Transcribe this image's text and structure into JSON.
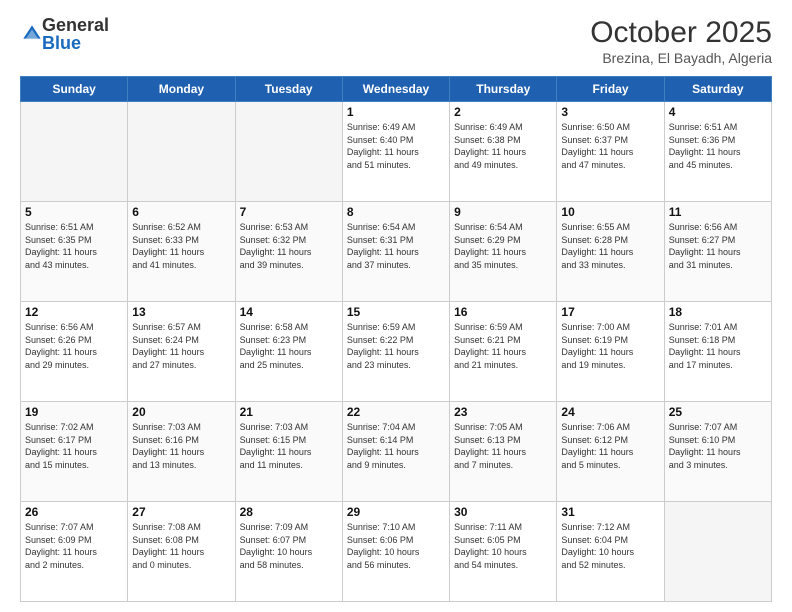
{
  "logo": {
    "general": "General",
    "blue": "Blue"
  },
  "header": {
    "month": "October 2025",
    "location": "Brezina, El Bayadh, Algeria"
  },
  "weekdays": [
    "Sunday",
    "Monday",
    "Tuesday",
    "Wednesday",
    "Thursday",
    "Friday",
    "Saturday"
  ],
  "weeks": [
    [
      {
        "day": "",
        "info": ""
      },
      {
        "day": "",
        "info": ""
      },
      {
        "day": "",
        "info": ""
      },
      {
        "day": "1",
        "info": "Sunrise: 6:49 AM\nSunset: 6:40 PM\nDaylight: 11 hours\nand 51 minutes."
      },
      {
        "day": "2",
        "info": "Sunrise: 6:49 AM\nSunset: 6:38 PM\nDaylight: 11 hours\nand 49 minutes."
      },
      {
        "day": "3",
        "info": "Sunrise: 6:50 AM\nSunset: 6:37 PM\nDaylight: 11 hours\nand 47 minutes."
      },
      {
        "day": "4",
        "info": "Sunrise: 6:51 AM\nSunset: 6:36 PM\nDaylight: 11 hours\nand 45 minutes."
      }
    ],
    [
      {
        "day": "5",
        "info": "Sunrise: 6:51 AM\nSunset: 6:35 PM\nDaylight: 11 hours\nand 43 minutes."
      },
      {
        "day": "6",
        "info": "Sunrise: 6:52 AM\nSunset: 6:33 PM\nDaylight: 11 hours\nand 41 minutes."
      },
      {
        "day": "7",
        "info": "Sunrise: 6:53 AM\nSunset: 6:32 PM\nDaylight: 11 hours\nand 39 minutes."
      },
      {
        "day": "8",
        "info": "Sunrise: 6:54 AM\nSunset: 6:31 PM\nDaylight: 11 hours\nand 37 minutes."
      },
      {
        "day": "9",
        "info": "Sunrise: 6:54 AM\nSunset: 6:29 PM\nDaylight: 11 hours\nand 35 minutes."
      },
      {
        "day": "10",
        "info": "Sunrise: 6:55 AM\nSunset: 6:28 PM\nDaylight: 11 hours\nand 33 minutes."
      },
      {
        "day": "11",
        "info": "Sunrise: 6:56 AM\nSunset: 6:27 PM\nDaylight: 11 hours\nand 31 minutes."
      }
    ],
    [
      {
        "day": "12",
        "info": "Sunrise: 6:56 AM\nSunset: 6:26 PM\nDaylight: 11 hours\nand 29 minutes."
      },
      {
        "day": "13",
        "info": "Sunrise: 6:57 AM\nSunset: 6:24 PM\nDaylight: 11 hours\nand 27 minutes."
      },
      {
        "day": "14",
        "info": "Sunrise: 6:58 AM\nSunset: 6:23 PM\nDaylight: 11 hours\nand 25 minutes."
      },
      {
        "day": "15",
        "info": "Sunrise: 6:59 AM\nSunset: 6:22 PM\nDaylight: 11 hours\nand 23 minutes."
      },
      {
        "day": "16",
        "info": "Sunrise: 6:59 AM\nSunset: 6:21 PM\nDaylight: 11 hours\nand 21 minutes."
      },
      {
        "day": "17",
        "info": "Sunrise: 7:00 AM\nSunset: 6:19 PM\nDaylight: 11 hours\nand 19 minutes."
      },
      {
        "day": "18",
        "info": "Sunrise: 7:01 AM\nSunset: 6:18 PM\nDaylight: 11 hours\nand 17 minutes."
      }
    ],
    [
      {
        "day": "19",
        "info": "Sunrise: 7:02 AM\nSunset: 6:17 PM\nDaylight: 11 hours\nand 15 minutes."
      },
      {
        "day": "20",
        "info": "Sunrise: 7:03 AM\nSunset: 6:16 PM\nDaylight: 11 hours\nand 13 minutes."
      },
      {
        "day": "21",
        "info": "Sunrise: 7:03 AM\nSunset: 6:15 PM\nDaylight: 11 hours\nand 11 minutes."
      },
      {
        "day": "22",
        "info": "Sunrise: 7:04 AM\nSunset: 6:14 PM\nDaylight: 11 hours\nand 9 minutes."
      },
      {
        "day": "23",
        "info": "Sunrise: 7:05 AM\nSunset: 6:13 PM\nDaylight: 11 hours\nand 7 minutes."
      },
      {
        "day": "24",
        "info": "Sunrise: 7:06 AM\nSunset: 6:12 PM\nDaylight: 11 hours\nand 5 minutes."
      },
      {
        "day": "25",
        "info": "Sunrise: 7:07 AM\nSunset: 6:10 PM\nDaylight: 11 hours\nand 3 minutes."
      }
    ],
    [
      {
        "day": "26",
        "info": "Sunrise: 7:07 AM\nSunset: 6:09 PM\nDaylight: 11 hours\nand 2 minutes."
      },
      {
        "day": "27",
        "info": "Sunrise: 7:08 AM\nSunset: 6:08 PM\nDaylight: 11 hours\nand 0 minutes."
      },
      {
        "day": "28",
        "info": "Sunrise: 7:09 AM\nSunset: 6:07 PM\nDaylight: 10 hours\nand 58 minutes."
      },
      {
        "day": "29",
        "info": "Sunrise: 7:10 AM\nSunset: 6:06 PM\nDaylight: 10 hours\nand 56 minutes."
      },
      {
        "day": "30",
        "info": "Sunrise: 7:11 AM\nSunset: 6:05 PM\nDaylight: 10 hours\nand 54 minutes."
      },
      {
        "day": "31",
        "info": "Sunrise: 7:12 AM\nSunset: 6:04 PM\nDaylight: 10 hours\nand 52 minutes."
      },
      {
        "day": "",
        "info": ""
      }
    ]
  ]
}
